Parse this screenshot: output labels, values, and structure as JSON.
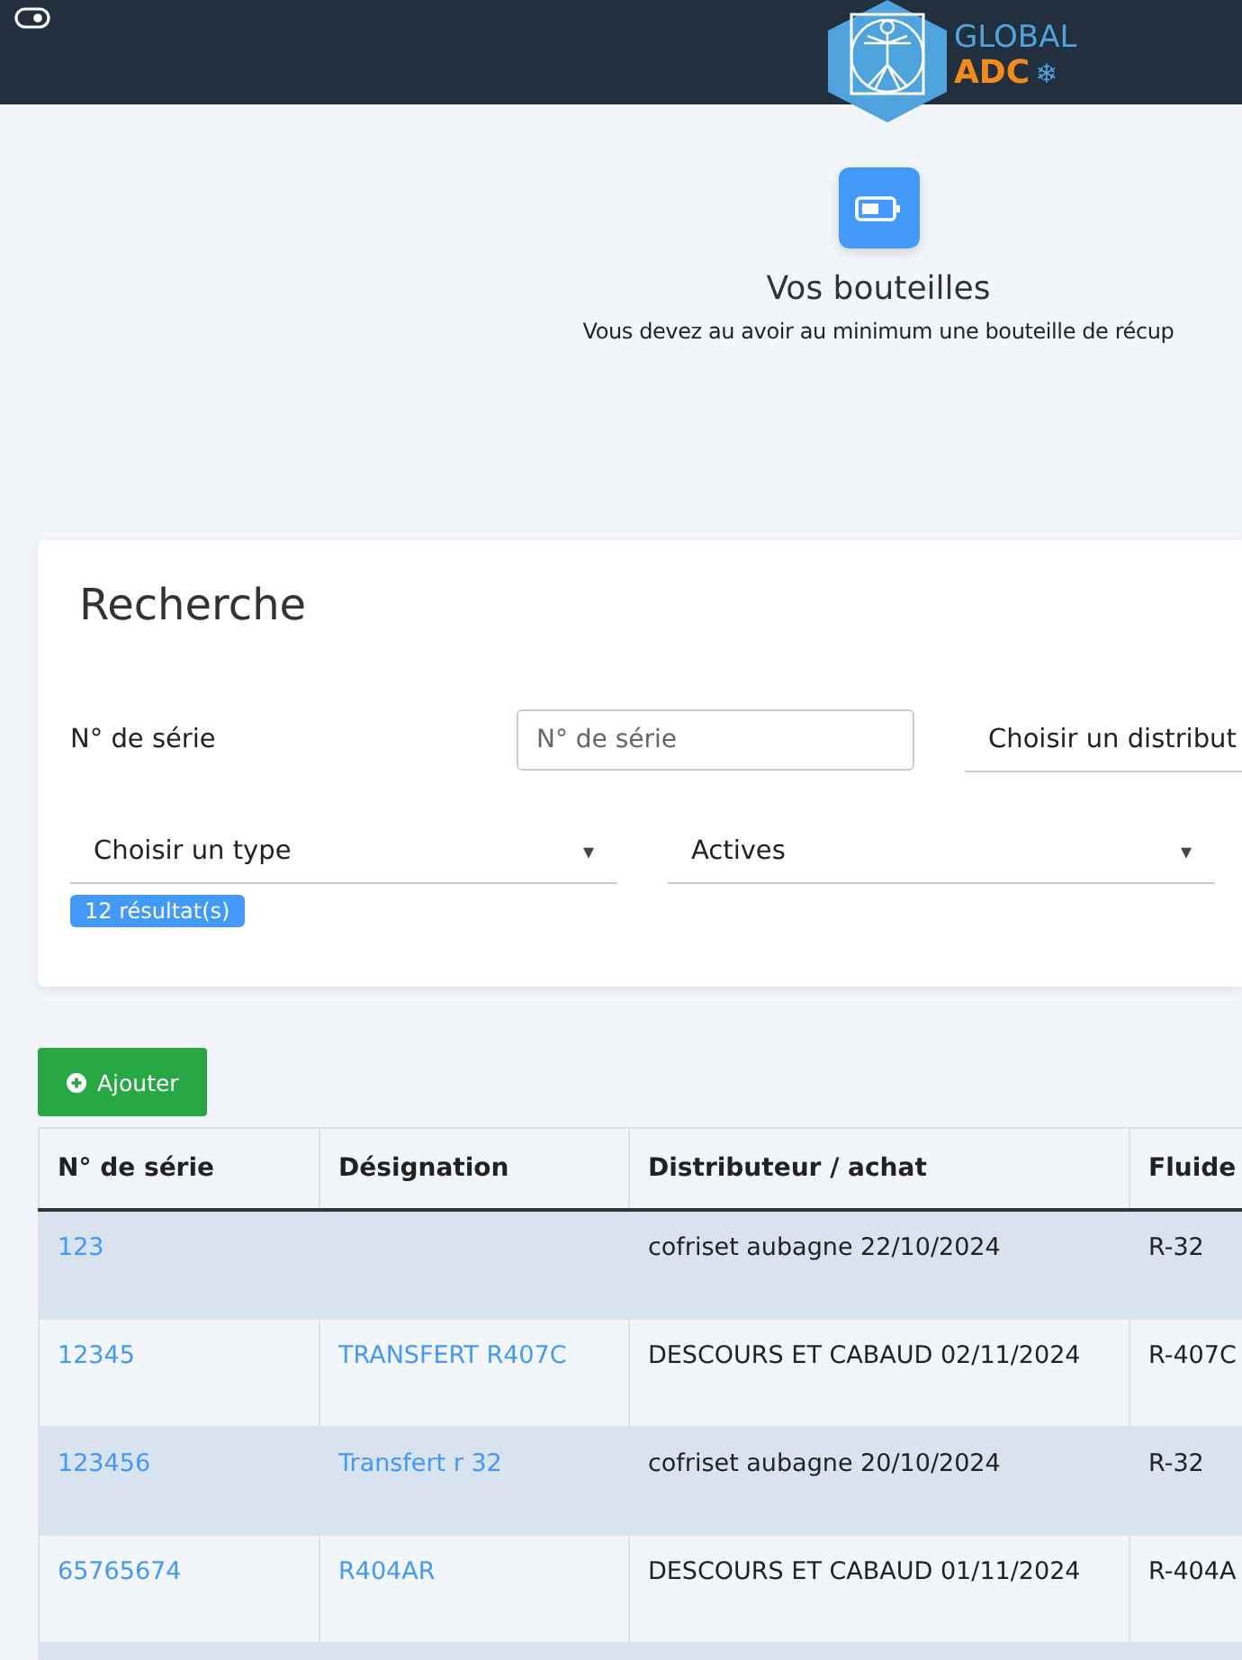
{
  "header": {
    "logo": {
      "line_1": "GLOBAL",
      "line_2": "ADC",
      "mark": "❄"
    }
  },
  "hero": {
    "title": "Vos bouteilles",
    "subtitle": "Vous devez au avoir au minimum une bouteille de récup"
  },
  "search": {
    "title": "Recherche",
    "serial_label": "N° de série",
    "serial_field": {
      "placeholder": "N° de série"
    },
    "distributor_select": {
      "value": "Choisir un distribut"
    },
    "type_select": {
      "value": "Choisir un type",
      "caret": "▾"
    },
    "status_select": {
      "value": "Actives",
      "caret": "▾"
    },
    "result_count": "12 résultat(s)"
  },
  "add_button": {
    "label": "Ajouter"
  },
  "table": {
    "columns": [
      "N° de série",
      "Désignation",
      "Distributeur / achat",
      "Fluide"
    ],
    "rows": [
      {
        "serial": "123",
        "designation": "",
        "distributor": "cofriset aubagne 22/10/2024",
        "fluid": "R-32"
      },
      {
        "serial": "12345",
        "designation": "TRANSFERT R407C",
        "distributor": "DESCOURS ET CABAUD 02/11/2024",
        "fluid": "R-407C"
      },
      {
        "serial": "123456",
        "designation": "Transfert r 32",
        "distributor": "cofriset aubagne 20/10/2024",
        "fluid": "R-32"
      },
      {
        "serial": "65765674",
        "designation": "R404AR",
        "distributor": "DESCOURS ET CABAUD 01/11/2024",
        "fluid": "R-404A"
      }
    ]
  }
}
